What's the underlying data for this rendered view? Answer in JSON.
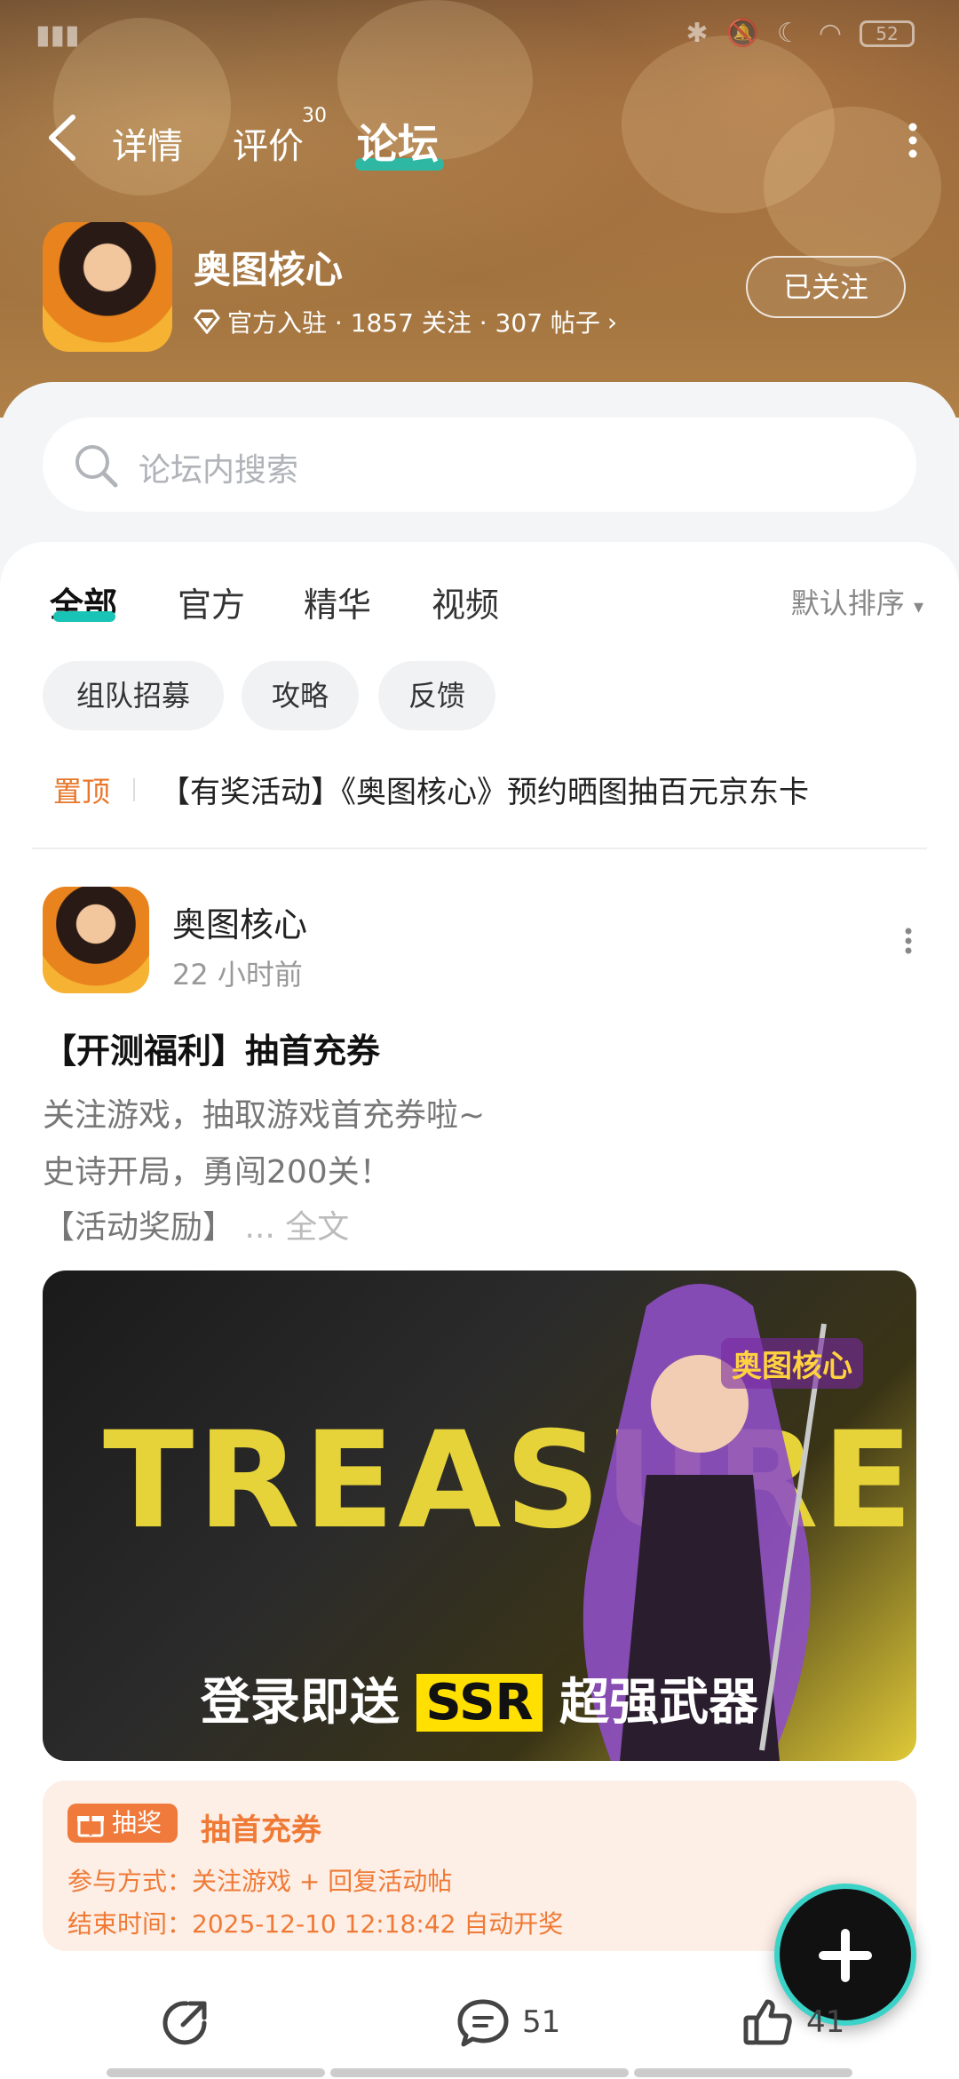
{
  "status": {
    "time": "",
    "battery": "52"
  },
  "nav": {
    "tabs": [
      {
        "label": "详情"
      },
      {
        "label": "评价",
        "badge": "30"
      },
      {
        "label": "论坛"
      }
    ]
  },
  "app": {
    "name": "奥图核心",
    "meta": "官方入驻 · 1857 关注 · 307 帖子",
    "follow_label": "已关注"
  },
  "search": {
    "placeholder": "论坛内搜索"
  },
  "filters": {
    "tabs": [
      "全部",
      "官方",
      "精华",
      "视频"
    ],
    "sort_label": "默认排序",
    "chips": [
      "组队招募",
      "攻略",
      "反馈"
    ]
  },
  "pinned": {
    "tag": "置顶",
    "text": "【有奖活动】《奥图核心》预约晒图抽百元京东卡"
  },
  "post": {
    "author": "奥图核心",
    "time": "22 小时前",
    "title": "【开测福利】抽首充券",
    "lines": [
      "关注游戏，抽取游戏首充券啦~",
      "史诗开局，勇闯200关！",
      "【活动奖励】"
    ],
    "more_link": "... 全文",
    "banner": {
      "word": "TREASURE",
      "logo": "奥图核心",
      "caption_pre": "登录即送",
      "caption_hl": "SSR",
      "caption_post": "超强武器"
    },
    "lottery": {
      "tag": "抽奖",
      "title": "抽首充券",
      "method": "参与方式：关注游戏 + 回复活动帖",
      "end": "结束时间：2025-12-10 12:18:42 自动开奖"
    },
    "actions": {
      "comments": "51",
      "likes": "41"
    }
  },
  "colors": {
    "accent": "#19c3b5",
    "orange": "#ef7a35"
  }
}
